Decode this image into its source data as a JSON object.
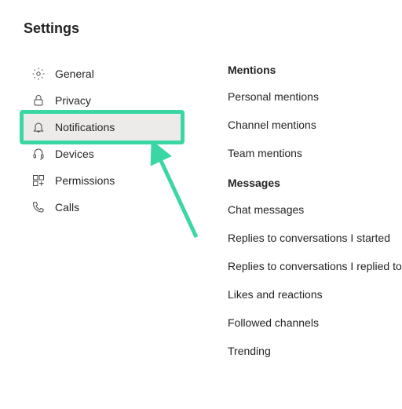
{
  "title": "Settings",
  "sidebar": {
    "items": [
      {
        "label": "General"
      },
      {
        "label": "Privacy"
      },
      {
        "label": "Notifications"
      },
      {
        "label": "Devices"
      },
      {
        "label": "Permissions"
      },
      {
        "label": "Calls"
      }
    ],
    "active_index": 2
  },
  "highlight": {
    "color": "#3ad6a4"
  },
  "content": {
    "sections": [
      {
        "header": "Mentions",
        "options": [
          "Personal mentions",
          "Channel mentions",
          "Team mentions"
        ]
      },
      {
        "header": "Messages",
        "options": [
          "Chat messages",
          "Replies to conversations I started",
          "Replies to conversations I replied to",
          "Likes and reactions",
          "Followed channels",
          "Trending"
        ]
      }
    ]
  }
}
